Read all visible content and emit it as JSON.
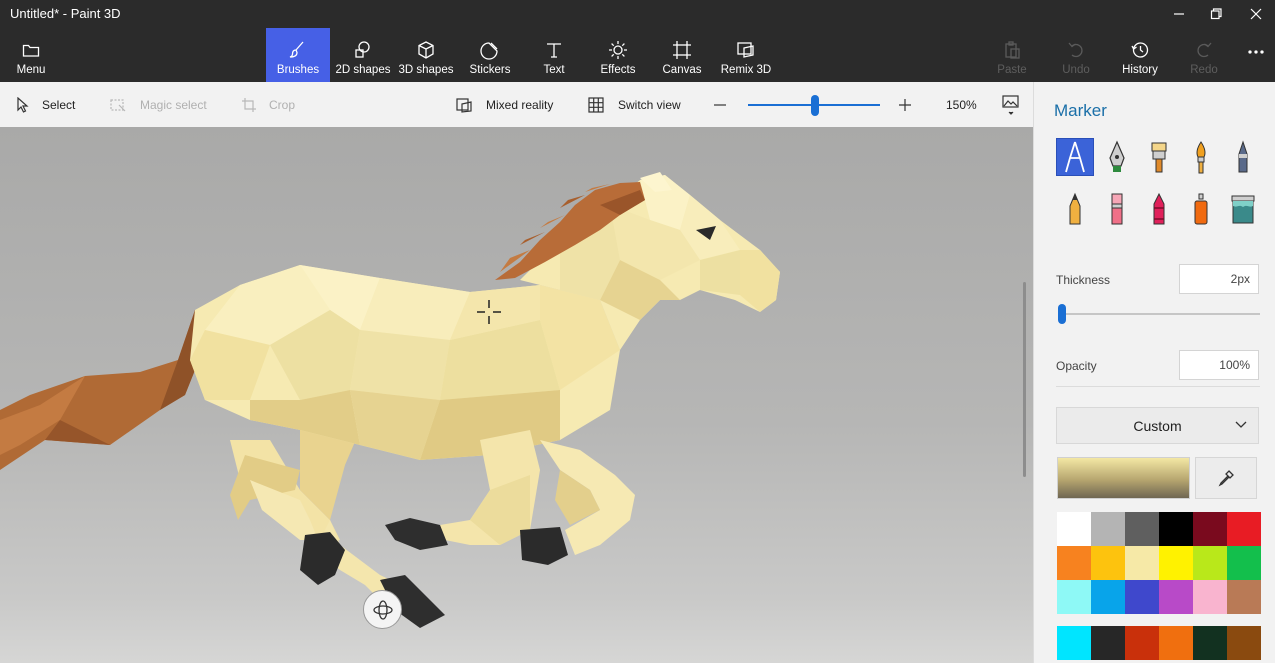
{
  "window": {
    "title": "Untitled* - Paint 3D",
    "controls": [
      "minimize",
      "maximize",
      "close"
    ]
  },
  "ribbon": {
    "menu": "Menu",
    "tools": [
      {
        "label": "Brushes",
        "icon": "brush-icon",
        "active": true
      },
      {
        "label": "2D shapes",
        "icon": "2d-shapes-icon"
      },
      {
        "label": "3D shapes",
        "icon": "3d-shapes-icon"
      },
      {
        "label": "Stickers",
        "icon": "stickers-icon"
      },
      {
        "label": "Text",
        "icon": "text-icon"
      },
      {
        "label": "Effects",
        "icon": "effects-icon"
      },
      {
        "label": "Canvas",
        "icon": "canvas-icon"
      },
      {
        "label": "Remix 3D",
        "icon": "remix-3d-icon"
      }
    ],
    "right_tools": [
      {
        "label": "Paste",
        "icon": "paste-icon",
        "disabled": true
      },
      {
        "label": "Undo",
        "icon": "undo-icon",
        "disabled": true
      },
      {
        "label": "History",
        "icon": "history-icon",
        "disabled": false
      },
      {
        "label": "Redo",
        "icon": "redo-icon",
        "disabled": true
      }
    ],
    "more": "more-icon"
  },
  "toolbar": {
    "select": "Select",
    "magic_select": "Magic select",
    "crop": "Crop",
    "mixed_reality": "Mixed reality",
    "switch_view": "Switch view",
    "zoom_level": "150%",
    "zoom_fraction": 0.5
  },
  "panel": {
    "title": "Marker",
    "tools": [
      "marker-icon",
      "calligraphy-pen-icon",
      "oil-brush-icon",
      "watercolor-icon",
      "pixel-pen-icon",
      "pencil-icon",
      "eraser-icon",
      "crayon-icon",
      "spray-can-icon",
      "fill-bucket-icon"
    ],
    "thickness_label": "Thickness",
    "thickness_value": "2px",
    "opacity_label": "Opacity",
    "opacity_value": "100%",
    "color_mode": "Custom",
    "current_color": "#e8dc9e",
    "palette": [
      "#ffffff",
      "#b4b4b4",
      "#5f5f5f",
      "#000000",
      "#7a0a1e",
      "#e81c24",
      "#f7821f",
      "#fdc30e",
      "#f6e9a7",
      "#fff200",
      "#b9e81a",
      "#13bf4c",
      "#8ef9f6",
      "#08a4ea",
      "#3f48cc",
      "#b84ac8",
      "#f9b4cf",
      "#b97a56",
      "#00e5ff",
      "#272727",
      "#c9300b",
      "#f06f0f",
      "#123120",
      "#8a4a0f"
    ]
  }
}
